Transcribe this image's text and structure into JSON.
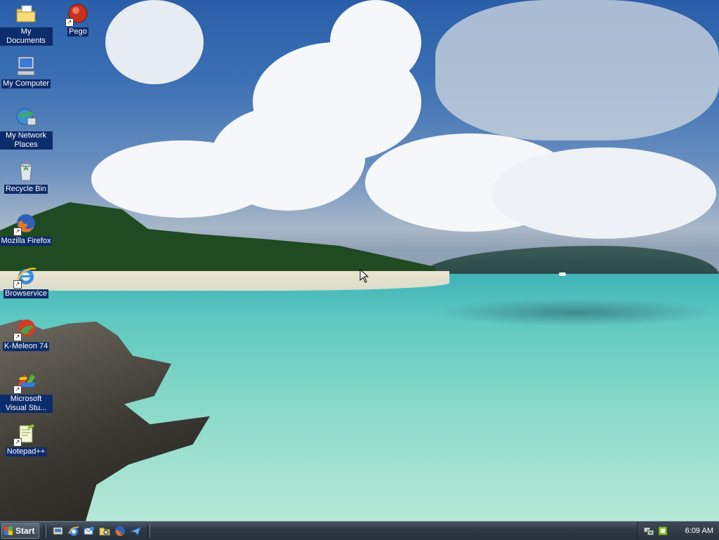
{
  "desktop": {
    "icons": [
      {
        "label": "My Documents",
        "icon": "folder-documents-icon"
      },
      {
        "label": "Pego",
        "icon": "pego-icon"
      },
      {
        "label": "My Computer",
        "icon": "computer-icon"
      },
      {
        "label": "My Network Places",
        "icon": "network-places-icon"
      },
      {
        "label": "Recycle Bin",
        "icon": "recycle-bin-icon"
      },
      {
        "label": "Mozilla Firefox",
        "icon": "firefox-icon"
      },
      {
        "label": "Browservice",
        "icon": "internet-explorer-icon"
      },
      {
        "label": "K-Meleon 74",
        "icon": "k-meleon-icon"
      },
      {
        "label": "Microsoft Visual Stu...",
        "icon": "visual-studio-icon"
      },
      {
        "label": "Notepad++",
        "icon": "notepad-plus-plus-icon"
      }
    ]
  },
  "taskbar": {
    "start_label": "Start",
    "quick_launch": [
      "show-desktop-icon",
      "internet-explorer-icon",
      "outlook-express-icon",
      "windows-explorer-icon",
      "firefox-icon",
      "messenger-icon"
    ],
    "tray_icons": [
      "network-tray-icon",
      "utility-tray-icon"
    ],
    "clock": "6:09 AM"
  },
  "colors": {
    "taskbar": "#2f3a45",
    "icon_label_bg": "#0d2c6b"
  }
}
